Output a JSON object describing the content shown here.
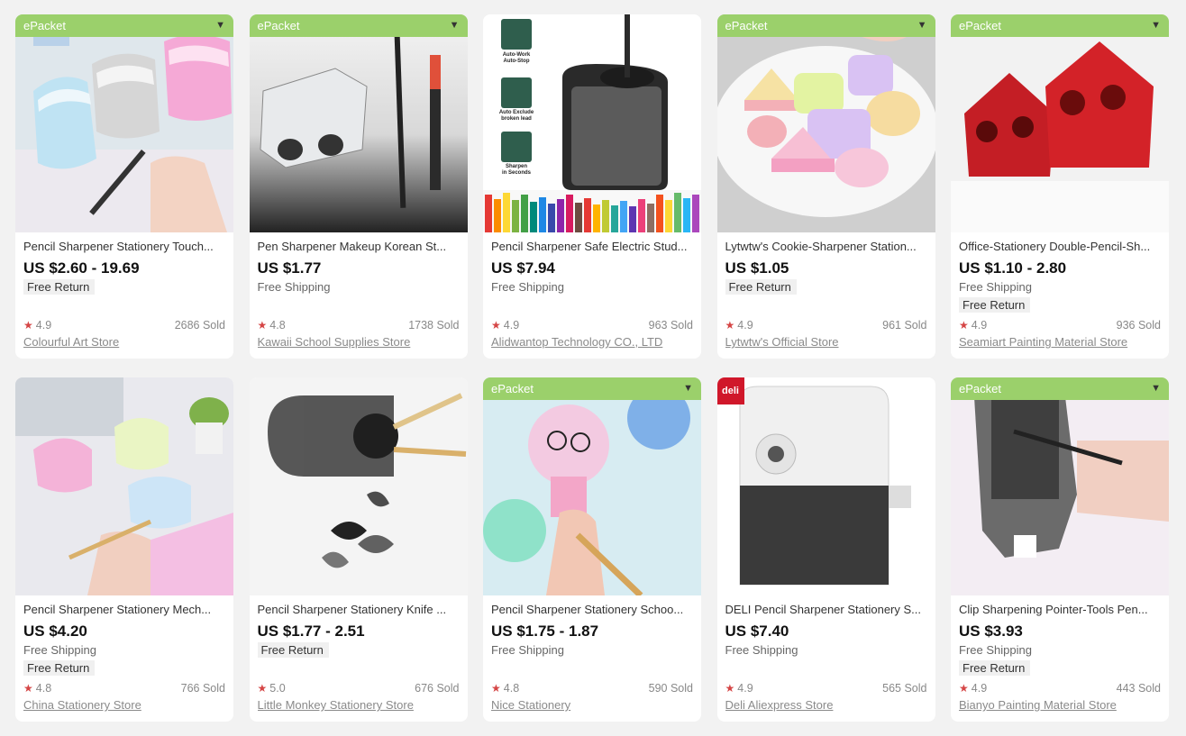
{
  "products": [
    {
      "epacket": "ePacket",
      "title": "Pencil Sharpener Stationery Touch...",
      "price": "US $2.60 - 19.69",
      "shipping": "",
      "free_return": "Free Return",
      "rating": "4.9",
      "sold": "2686 Sold",
      "store": "Colourful Art Store",
      "image": "image-1"
    },
    {
      "epacket": "ePacket",
      "title": "Pen Sharpener Makeup Korean St...",
      "price": "US $1.77",
      "shipping": "Free Shipping",
      "free_return": "",
      "rating": "4.8",
      "sold": "1738 Sold",
      "store": "Kawaii School Supplies Store",
      "image": "image-2"
    },
    {
      "epacket": "",
      "title": "Pencil Sharpener Safe Electric Stud...",
      "price": "US $7.94",
      "shipping": "Free Shipping",
      "free_return": "",
      "rating": "4.9",
      "sold": "963 Sold",
      "store": "Alidwantop Technology CO., LTD",
      "image": "image-3",
      "features": [
        "Auto-Work Auto-Stop",
        "Auto Exclude broken lead",
        "Sharpen in Seconds"
      ]
    },
    {
      "epacket": "ePacket",
      "title": "Lytwtw's Cookie-Sharpener Station...",
      "price": "US $1.05",
      "shipping": "",
      "free_return": "Free Return",
      "rating": "4.9",
      "sold": "961 Sold",
      "store": "Lytwtw's Official Store",
      "image": "image-4"
    },
    {
      "epacket": "ePacket",
      "title": "Office-Stationery Double-Pencil-Sh...",
      "price": "US $1.10 - 2.80",
      "shipping": "Free Shipping",
      "free_return": "Free Return",
      "rating": "4.9",
      "sold": "936 Sold",
      "store": "Seamiart Painting Material Store",
      "image": "image-5"
    },
    {
      "epacket": "",
      "title": "Pencil Sharpener Stationery Mech...",
      "price": "US $4.20",
      "shipping": "Free Shipping",
      "free_return": "Free Return",
      "rating": "4.8",
      "sold": "766 Sold",
      "store": "China Stationery Store",
      "image": "image-6"
    },
    {
      "epacket": "",
      "title": "Pencil Sharpener Stationery Knife ...",
      "price": "US $1.77 - 2.51",
      "shipping": "",
      "free_return": "Free Return",
      "rating": "5.0",
      "sold": "676 Sold",
      "store": "Little Monkey Stationery Store",
      "image": "image-7"
    },
    {
      "epacket": "ePacket",
      "title": "Pencil Sharpener Stationery Schoo...",
      "price": "US $1.75 - 1.87",
      "shipping": "Free Shipping",
      "free_return": "",
      "rating": "4.8",
      "sold": "590 Sold",
      "store": "Nice Stationery",
      "image": "image-8"
    },
    {
      "epacket": "",
      "title": "DELI Pencil Sharpener Stationery S...",
      "price": "US $7.40",
      "shipping": "Free Shipping",
      "free_return": "",
      "rating": "4.9",
      "sold": "565 Sold",
      "store": "Deli Aliexpress Store",
      "image": "image-9",
      "brand_logo": "deli"
    },
    {
      "epacket": "ePacket",
      "title": "Clip Sharpening Pointer-Tools Pen...",
      "price": "US $3.93",
      "shipping": "Free Shipping",
      "free_return": "Free Return",
      "rating": "4.9",
      "sold": "443 Sold",
      "store": "Bianyo Painting Material Store",
      "image": "image-10"
    }
  ],
  "icons": {
    "star": "star-icon",
    "chevron": "chevron-down-icon"
  },
  "colors": {
    "epacket_green": "#9bd06b",
    "star_red": "#d54545",
    "deli_red": "#d0172a"
  }
}
